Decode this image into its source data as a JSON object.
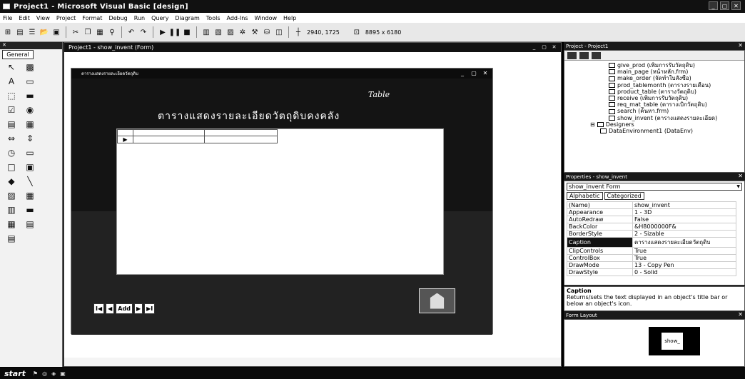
{
  "window": {
    "title": "Project1 - Microsoft Visual Basic [design]",
    "controls": [
      "_",
      "▢",
      "✕"
    ]
  },
  "menu": [
    "File",
    "Edit",
    "View",
    "Project",
    "Format",
    "Debug",
    "Run",
    "Query",
    "Diagram",
    "Tools",
    "Add-Ins",
    "Window",
    "Help"
  ],
  "toolbar": {
    "position_readout": "2940, 1725",
    "size_readout": "8895 x 6180"
  },
  "toolbox": {
    "tab_label": "General",
    "tools": [
      "pointer-tool",
      "picturebox-tool",
      "label-tool",
      "textbox-tool",
      "frame-tool",
      "commandbutton-tool",
      "checkbox-tool",
      "optionbutton-tool",
      "combobox-tool",
      "listbox-tool",
      "hscrollbar-tool",
      "vscrollbar-tool",
      "timer-tool",
      "drivelistbox-tool",
      "dirlistbox-tool",
      "filelistbox-tool",
      "shape-tool",
      "line-tool",
      "image-tool",
      "data-tool",
      "ole-tool",
      "adodc-tool",
      "datagrid-tool",
      "datalist-tool",
      "datacombo-tool"
    ]
  },
  "designer": {
    "title": "Project1 - show_invent (Form)",
    "form": {
      "heading_small": "Table",
      "heading": "ตารางแสดงรายละเอียดวัตถุดิบคงคลัง",
      "navigation": {
        "first": "I◀",
        "prev": "◀",
        "add": "Add",
        "next": "▶",
        "last": "▶I"
      },
      "grid_marker": "▶"
    }
  },
  "project_explorer": {
    "title": "Project - Project1",
    "items": [
      "give_prod (เพิ่มการรับวัตถุดิบ)",
      "main_page (หน้าหลัก.frm)",
      "make_order (จัดทำใบสั่งซื้อ)",
      "prod_tablemonth (ตารางรายเดือน)",
      "product_table (ตารางวัตถุดิบ)",
      "receive (เพิ่มการรับวัตถุดิบ)",
      "req_mat_table (ตารางเบิกวัตถุดิบ)",
      "search (ค้นหา.frm)",
      "show_invent (ตารางแสดงรายละเอียด)"
    ],
    "designers_label": "Designers",
    "designer_item": "DataEnvironment1 (DataEnv)"
  },
  "properties": {
    "title": "Properties - show_invent",
    "selected_object": "show_invent  Form",
    "tabs": [
      "Alphabetic",
      "Categorized"
    ],
    "rows": [
      {
        "name": "(Name)",
        "value": "show_invent"
      },
      {
        "name": "Appearance",
        "value": "1 - 3D"
      },
      {
        "name": "AutoRedraw",
        "value": "False"
      },
      {
        "name": "BackColor",
        "value": "&H8000000F&"
      },
      {
        "name": "BorderStyle",
        "value": "2 - Sizable"
      },
      {
        "name": "Caption",
        "value": "ตารางแสดงรายละเอียดวัตถุดิบ"
      },
      {
        "name": "ClipControls",
        "value": "True"
      },
      {
        "name": "ControlBox",
        "value": "True"
      },
      {
        "name": "DrawMode",
        "value": "13 - Copy Pen"
      },
      {
        "name": "DrawStyle",
        "value": "0 - Solid"
      }
    ]
  },
  "caption_help": {
    "title": "Caption",
    "text": "Returns/sets the text displayed in an object's title bar or below an object's icon."
  },
  "form_layout": {
    "title": "Form Layout",
    "form_label": "show_"
  },
  "taskbar": {
    "start": "start"
  }
}
